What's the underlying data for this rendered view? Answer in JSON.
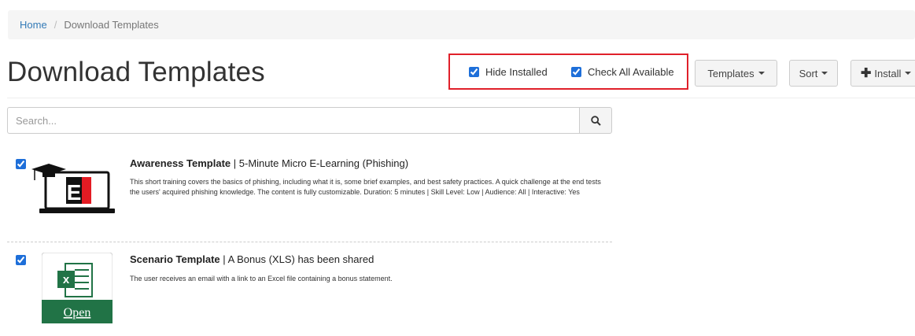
{
  "breadcrumb": {
    "home": "Home",
    "separator": "/",
    "current": "Download Templates"
  },
  "page": {
    "title": "Download Templates"
  },
  "filters": {
    "hide_installed": "Hide Installed",
    "check_all": "Check All Available"
  },
  "toolbar": {
    "templates": "Templates",
    "sort": "Sort",
    "install": "Install"
  },
  "search": {
    "placeholder": "Search..."
  },
  "items": [
    {
      "type": "Awareness Template",
      "separator": "|",
      "name": "5-Minute Micro E-Learning (Phishing)",
      "description": "This short training covers the basics of phishing, including what it is, some brief examples, and best safety practices. A quick challenge at the end tests the users' acquired phishing knowledge. The content is fully customizable. Duration: 5 minutes | Skill Level: Low | Audience: All | Interactive: Yes",
      "thumb_letter": "E",
      "checked": true
    },
    {
      "type": "Scenario Template",
      "separator": "|",
      "name": "A Bonus (XLS) has been shared",
      "description": "The user receives an email with a link to an Excel file containing a bonus statement.",
      "thumb_text": "Open",
      "thumb_letter": "x",
      "checked": true
    }
  ],
  "colors": {
    "accent": "#337ab7",
    "highlight": "#e0202a",
    "excel_green": "#217346",
    "elearning_red": "#e31b23"
  }
}
